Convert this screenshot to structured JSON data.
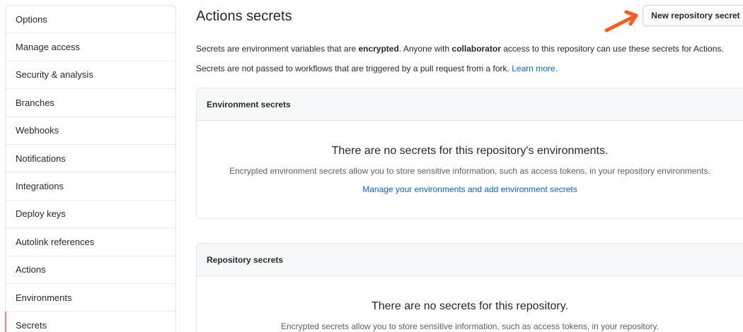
{
  "sidebar": {
    "items": [
      {
        "label": "Options"
      },
      {
        "label": "Manage access"
      },
      {
        "label": "Security & analysis"
      },
      {
        "label": "Branches"
      },
      {
        "label": "Webhooks"
      },
      {
        "label": "Notifications"
      },
      {
        "label": "Integrations"
      },
      {
        "label": "Deploy keys"
      },
      {
        "label": "Autolink references"
      },
      {
        "label": "Actions"
      },
      {
        "label": "Environments"
      },
      {
        "label": "Secrets"
      }
    ],
    "selected": "Secrets",
    "selected_color": "#f9826c"
  },
  "header": {
    "title": "Actions secrets",
    "new_button_label": "New repository secret",
    "arrow_color": "#ff5a1f"
  },
  "description": {
    "line1_a": "Secrets are environment variables that are ",
    "line1_b": "encrypted",
    "line1_c": ". Anyone with ",
    "line1_d": "collaborator",
    "line1_e": " access to this repository can use these secrets for Actions.",
    "line2_a": "Secrets are not passed to workflows that are triggered by a pull request from a fork. ",
    "line2_link": "Learn more."
  },
  "environment_secrets": {
    "header": "Environment secrets",
    "empty_title": "There are no secrets for this repository's environments.",
    "empty_text": "Encrypted environment secrets allow you to store sensitive information, such as access tokens, in your repository environments.",
    "link": "Manage your environments and add environment secrets"
  },
  "repository_secrets": {
    "header": "Repository secrets",
    "empty_title": "There are no secrets for this repository.",
    "empty_text": "Encrypted secrets allow you to store sensitive information, such as access tokens, in your repository."
  }
}
